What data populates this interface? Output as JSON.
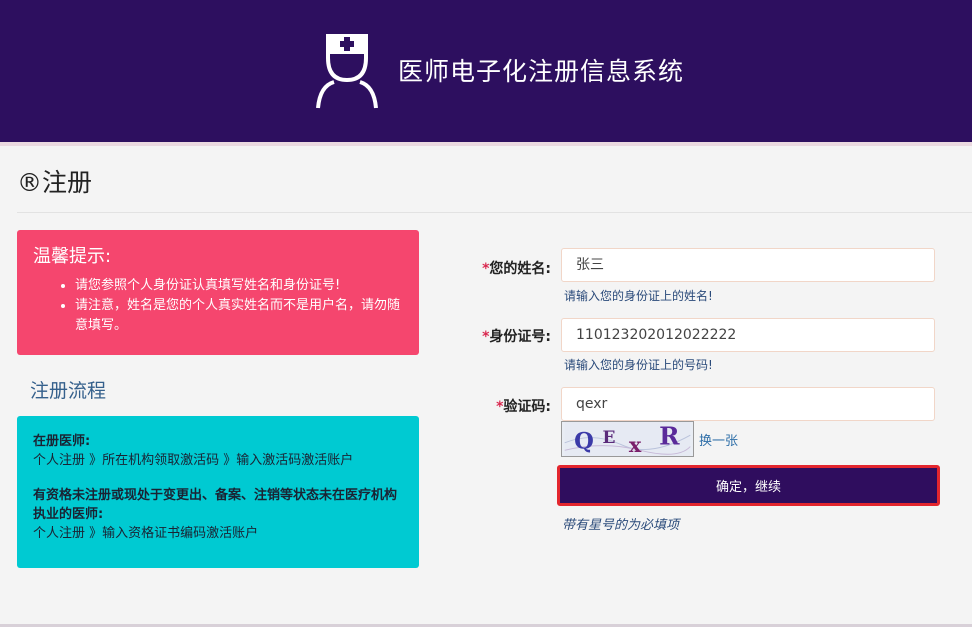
{
  "header": {
    "site_title": "医师电子化注册信息系统",
    "logo_icon": "doctor-nurse-icon",
    "background_color": "#2d0f5f"
  },
  "page": {
    "title": "®注册"
  },
  "tips": {
    "title": "温馨提示:",
    "items": [
      "请您参照个人身份证认真填写姓名和身份证号!",
      "请注意，姓名是您的个人真实姓名而不是用户名，请勿随意填写。"
    ],
    "background_color": "#f5466e"
  },
  "flow": {
    "heading": "注册流程",
    "section1_title": "在册医师:",
    "section1_steps": "个人注册 》所在机构领取激活码 》输入激活码激活账户",
    "section2_title": "有资格未注册或现处于变更出、备案、注销等状态未在医疗机构执业的医师:",
    "section2_steps": "个人注册 》输入资格证书编码激活账户",
    "background_color": "#00cad2"
  },
  "form": {
    "required_mark": "*",
    "name_label": "您的姓名:",
    "name_value": "张三",
    "name_hint": "请输入您的身份证上的姓名!",
    "id_label": "身份证号:",
    "id_value": "110123202012022222",
    "id_hint": "请输入您的身份证上的号码!",
    "captcha_label": "验证码:",
    "captcha_value": "qexr",
    "captcha_image_text": "QExR",
    "refresh_link": "换一张",
    "submit_label": "确定，继续",
    "required_note": "带有星号的为必填项",
    "submit_color": "#2f0d5e",
    "highlight_color": "#e3262e"
  }
}
